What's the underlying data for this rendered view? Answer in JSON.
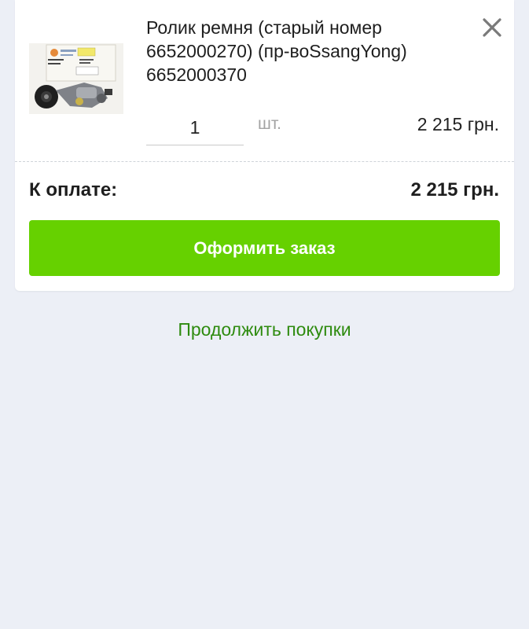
{
  "cart": {
    "item": {
      "title_line1": "Ролик ремня (старый номер",
      "title_line2": "6652000270) (пр-воSsangYong)",
      "title_line3": "6652000370",
      "quantity": "1",
      "unit": "шт.",
      "price": "2 215 грн.",
      "image_icon": "product-photo-belt-tensioner",
      "remove_icon": "close-icon"
    },
    "total": {
      "label": "К оплате:",
      "value": "2 215 грн."
    },
    "checkout_button_label": "Оформить заказ",
    "continue_link_label": "Продолжить покупки"
  },
  "colors": {
    "page_background": "#eceff6",
    "card_background": "#ffffff",
    "accent_green": "#66d100",
    "link_green": "#2e8b0f",
    "unit_gray": "#a3a3a3"
  }
}
